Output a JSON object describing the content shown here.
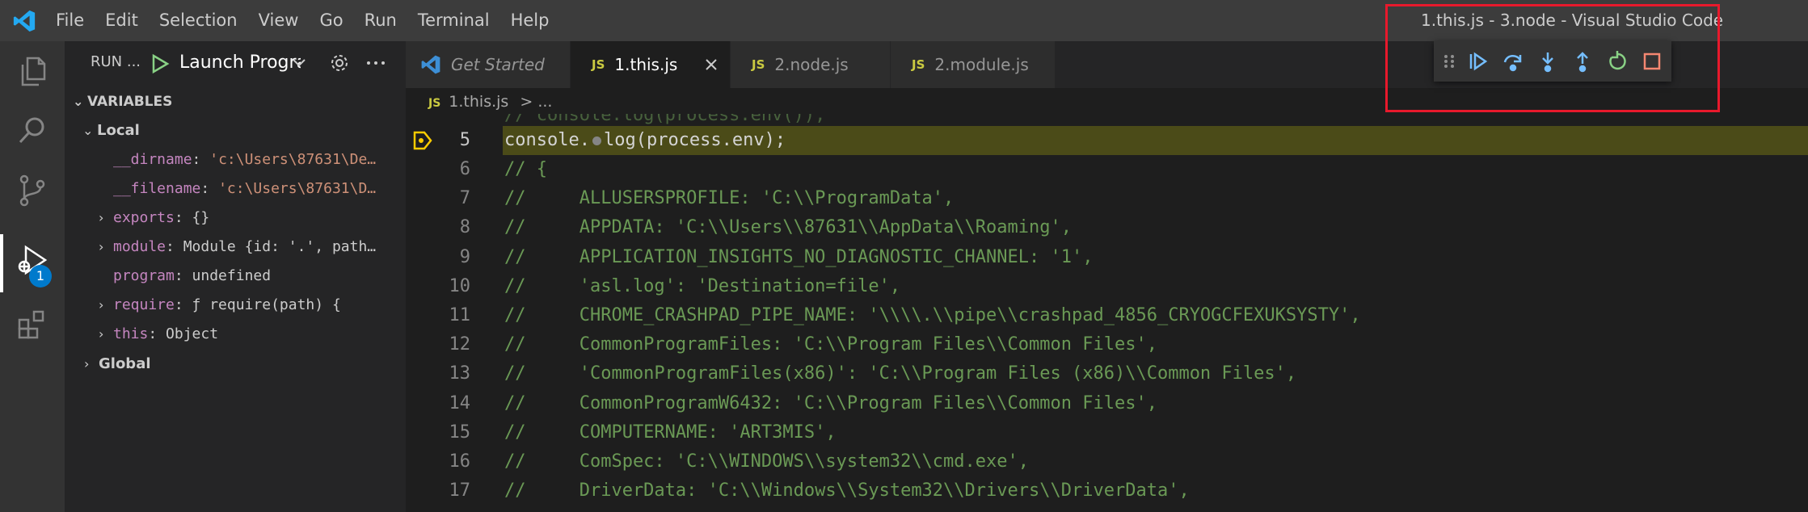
{
  "window": {
    "title": "1.this.js - 3.node - Visual Studio Code",
    "menu": [
      "File",
      "Edit",
      "Selection",
      "View",
      "Go",
      "Run",
      "Terminal",
      "Help"
    ]
  },
  "activity": {
    "items": [
      "files-icon",
      "search-icon",
      "source-control-icon",
      "run-debug-icon",
      "extensions-icon"
    ],
    "debug_badge": "1"
  },
  "sidebar": {
    "run_label": "RUN ...",
    "launch_config": "Launch Program",
    "variables_title": "VARIABLES",
    "local_scope": "Local",
    "global_scope": "Global",
    "vars": [
      {
        "name": "__dirname",
        "value": "'c:\\Users\\87631\\De…",
        "kind": "str",
        "expandable": false
      },
      {
        "name": "__filename",
        "value": "'c:\\Users\\87631\\D…",
        "kind": "str",
        "expandable": false
      },
      {
        "name": "exports",
        "value": "{}",
        "kind": "obj",
        "expandable": true
      },
      {
        "name": "module",
        "value": "Module {id: '.', path…",
        "kind": "obj",
        "expandable": true
      },
      {
        "name": "program",
        "value": "undefined",
        "kind": "obj",
        "expandable": false
      },
      {
        "name": "require",
        "value": "ƒ require(path) {",
        "kind": "obj",
        "expandable": true
      },
      {
        "name": "this",
        "value": "Object",
        "kind": "obj",
        "expandable": true
      }
    ]
  },
  "tabs": [
    {
      "lang": "",
      "label": "Get Started",
      "active": false,
      "italic": true
    },
    {
      "lang": "JS",
      "label": "1.this.js",
      "active": true,
      "italic": false
    },
    {
      "lang": "JS",
      "label": "2.node.js",
      "active": false,
      "italic": false
    },
    {
      "lang": "JS",
      "label": "2.module.js",
      "active": false,
      "italic": false
    }
  ],
  "breadcrumb": {
    "lang": "JS",
    "file": "1.this.js",
    "rest": "> ..."
  },
  "editor": {
    "ghost_text": "// console.log(process.env());",
    "current_line": {
      "num": "5",
      "before": "console.",
      "after": "log(process.env);"
    },
    "lines": [
      {
        "num": "6",
        "text": "// {"
      },
      {
        "num": "7",
        "text": "//     ALLUSERSPROFILE: 'C:\\\\ProgramData',"
      },
      {
        "num": "8",
        "text": "//     APPDATA: 'C:\\\\Users\\\\87631\\\\AppData\\\\Roaming',"
      },
      {
        "num": "9",
        "text": "//     APPLICATION_INSIGHTS_NO_DIAGNOSTIC_CHANNEL: '1',"
      },
      {
        "num": "10",
        "text": "//     'asl.log': 'Destination=file',"
      },
      {
        "num": "11",
        "text": "//     CHROME_CRASHPAD_PIPE_NAME: '\\\\\\\\.\\\\pipe\\\\crashpad_4856_CRYOGCFEXUKSYSTY',"
      },
      {
        "num": "12",
        "text": "//     CommonProgramFiles: 'C:\\\\Program Files\\\\Common Files',"
      },
      {
        "num": "13",
        "text": "//     'CommonProgramFiles(x86)': 'C:\\\\Program Files (x86)\\\\Common Files',"
      },
      {
        "num": "14",
        "text": "//     CommonProgramW6432: 'C:\\\\Program Files\\\\Common Files',"
      },
      {
        "num": "15",
        "text": "//     COMPUTERNAME: 'ART3MIS',"
      },
      {
        "num": "16",
        "text": "//     ComSpec: 'C:\\\\WINDOWS\\\\system32\\\\cmd.exe',"
      },
      {
        "num": "17",
        "text": "//     DriverData: 'C:\\\\Windows\\\\System32\\\\Drivers\\\\DriverData',"
      }
    ]
  },
  "debug_toolbar": {
    "buttons": [
      "drag-handle-icon",
      "continue-icon",
      "step-over-icon",
      "step-into-icon",
      "step-out-icon",
      "restart-icon",
      "stop-icon"
    ],
    "colors": {
      "action": "#75beff",
      "restart": "#89d185",
      "stop": "#f48771"
    }
  },
  "colors": {
    "accent": "#007acc",
    "highlight_box": "#e8192c"
  }
}
